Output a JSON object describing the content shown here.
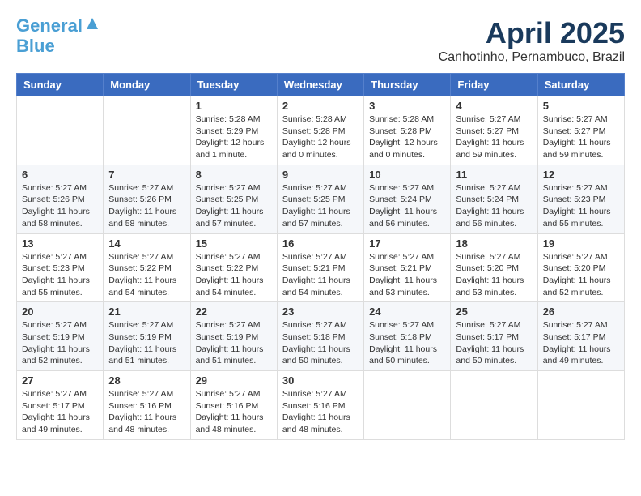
{
  "header": {
    "logo_line1": "General",
    "logo_line2": "Blue",
    "month_title": "April 2025",
    "location": "Canhotinho, Pernambuco, Brazil"
  },
  "days_of_week": [
    "Sunday",
    "Monday",
    "Tuesday",
    "Wednesday",
    "Thursday",
    "Friday",
    "Saturday"
  ],
  "weeks": [
    [
      {
        "day": "",
        "info": ""
      },
      {
        "day": "",
        "info": ""
      },
      {
        "day": "1",
        "info": "Sunrise: 5:28 AM\nSunset: 5:29 PM\nDaylight: 12 hours and 1 minute."
      },
      {
        "day": "2",
        "info": "Sunrise: 5:28 AM\nSunset: 5:28 PM\nDaylight: 12 hours and 0 minutes."
      },
      {
        "day": "3",
        "info": "Sunrise: 5:28 AM\nSunset: 5:28 PM\nDaylight: 12 hours and 0 minutes."
      },
      {
        "day": "4",
        "info": "Sunrise: 5:27 AM\nSunset: 5:27 PM\nDaylight: 11 hours and 59 minutes."
      },
      {
        "day": "5",
        "info": "Sunrise: 5:27 AM\nSunset: 5:27 PM\nDaylight: 11 hours and 59 minutes."
      }
    ],
    [
      {
        "day": "6",
        "info": "Sunrise: 5:27 AM\nSunset: 5:26 PM\nDaylight: 11 hours and 58 minutes."
      },
      {
        "day": "7",
        "info": "Sunrise: 5:27 AM\nSunset: 5:26 PM\nDaylight: 11 hours and 58 minutes."
      },
      {
        "day": "8",
        "info": "Sunrise: 5:27 AM\nSunset: 5:25 PM\nDaylight: 11 hours and 57 minutes."
      },
      {
        "day": "9",
        "info": "Sunrise: 5:27 AM\nSunset: 5:25 PM\nDaylight: 11 hours and 57 minutes."
      },
      {
        "day": "10",
        "info": "Sunrise: 5:27 AM\nSunset: 5:24 PM\nDaylight: 11 hours and 56 minutes."
      },
      {
        "day": "11",
        "info": "Sunrise: 5:27 AM\nSunset: 5:24 PM\nDaylight: 11 hours and 56 minutes."
      },
      {
        "day": "12",
        "info": "Sunrise: 5:27 AM\nSunset: 5:23 PM\nDaylight: 11 hours and 55 minutes."
      }
    ],
    [
      {
        "day": "13",
        "info": "Sunrise: 5:27 AM\nSunset: 5:23 PM\nDaylight: 11 hours and 55 minutes."
      },
      {
        "day": "14",
        "info": "Sunrise: 5:27 AM\nSunset: 5:22 PM\nDaylight: 11 hours and 54 minutes."
      },
      {
        "day": "15",
        "info": "Sunrise: 5:27 AM\nSunset: 5:22 PM\nDaylight: 11 hours and 54 minutes."
      },
      {
        "day": "16",
        "info": "Sunrise: 5:27 AM\nSunset: 5:21 PM\nDaylight: 11 hours and 54 minutes."
      },
      {
        "day": "17",
        "info": "Sunrise: 5:27 AM\nSunset: 5:21 PM\nDaylight: 11 hours and 53 minutes."
      },
      {
        "day": "18",
        "info": "Sunrise: 5:27 AM\nSunset: 5:20 PM\nDaylight: 11 hours and 53 minutes."
      },
      {
        "day": "19",
        "info": "Sunrise: 5:27 AM\nSunset: 5:20 PM\nDaylight: 11 hours and 52 minutes."
      }
    ],
    [
      {
        "day": "20",
        "info": "Sunrise: 5:27 AM\nSunset: 5:19 PM\nDaylight: 11 hours and 52 minutes."
      },
      {
        "day": "21",
        "info": "Sunrise: 5:27 AM\nSunset: 5:19 PM\nDaylight: 11 hours and 51 minutes."
      },
      {
        "day": "22",
        "info": "Sunrise: 5:27 AM\nSunset: 5:19 PM\nDaylight: 11 hours and 51 minutes."
      },
      {
        "day": "23",
        "info": "Sunrise: 5:27 AM\nSunset: 5:18 PM\nDaylight: 11 hours and 50 minutes."
      },
      {
        "day": "24",
        "info": "Sunrise: 5:27 AM\nSunset: 5:18 PM\nDaylight: 11 hours and 50 minutes."
      },
      {
        "day": "25",
        "info": "Sunrise: 5:27 AM\nSunset: 5:17 PM\nDaylight: 11 hours and 50 minutes."
      },
      {
        "day": "26",
        "info": "Sunrise: 5:27 AM\nSunset: 5:17 PM\nDaylight: 11 hours and 49 minutes."
      }
    ],
    [
      {
        "day": "27",
        "info": "Sunrise: 5:27 AM\nSunset: 5:17 PM\nDaylight: 11 hours and 49 minutes."
      },
      {
        "day": "28",
        "info": "Sunrise: 5:27 AM\nSunset: 5:16 PM\nDaylight: 11 hours and 48 minutes."
      },
      {
        "day": "29",
        "info": "Sunrise: 5:27 AM\nSunset: 5:16 PM\nDaylight: 11 hours and 48 minutes."
      },
      {
        "day": "30",
        "info": "Sunrise: 5:27 AM\nSunset: 5:16 PM\nDaylight: 11 hours and 48 minutes."
      },
      {
        "day": "",
        "info": ""
      },
      {
        "day": "",
        "info": ""
      },
      {
        "day": "",
        "info": ""
      }
    ]
  ]
}
